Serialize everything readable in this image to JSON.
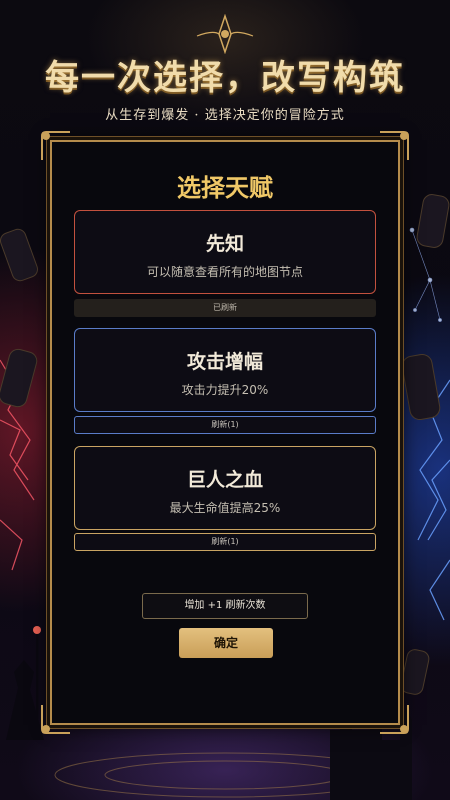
{
  "header": {
    "title": "每一次选择，改写构筑",
    "subtitle": "从生存到爆发 · 选择决定你的冒险方式"
  },
  "panel": {
    "title": "选择天赋",
    "talents": [
      {
        "name": "先知",
        "description": "可以随意查看所有的地图节点",
        "refresh_label": "已刷新",
        "accent": "#c2513e"
      },
      {
        "name": "攻击增幅",
        "description": "攻击力提升20%",
        "refresh_label": "刷新(1)",
        "accent": "#5a7cc8"
      },
      {
        "name": "巨人之血",
        "description": "最大生命值提高25%",
        "refresh_label": "刷新(1)",
        "accent": "#c9a463"
      }
    ],
    "add_refresh_label": "增加 +1 刷新次数",
    "confirm_label": "确定"
  },
  "colors": {
    "gold": "#f0c867",
    "frame": "#b58c4c",
    "confirm": "#dcb66f"
  }
}
